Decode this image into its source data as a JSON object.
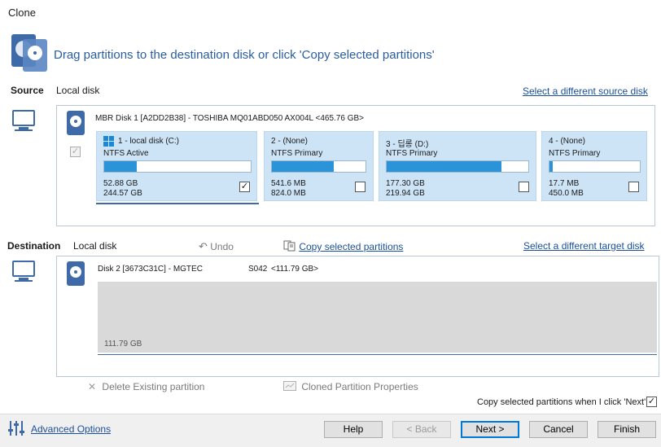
{
  "window": {
    "title": "Clone"
  },
  "header": {
    "instruction": "Drag partitions to the destination disk or click 'Copy selected partitions'"
  },
  "source": {
    "label": "Source",
    "disk_type": "Local disk",
    "select_link": "Select a different source disk",
    "disk_name": "MBR Disk 1 [A2DD2B38] - TOSHIBA MQ01ABD050 AX004L  <465.76 GB>",
    "partitions": [
      {
        "title": "1 - local disk (C:)",
        "fs": "NTFS Active",
        "used": "52.88 GB",
        "total": "244.57 GB",
        "fill_fraction": 0.22,
        "checked": true
      },
      {
        "title": "2 -  (None)",
        "fs": "NTFS Primary",
        "used": "541.6 MB",
        "total": "824.0 MB",
        "fill_fraction": 0.66,
        "checked": false
      },
      {
        "title": "3 - 딥롱 (D:)",
        "fs": "NTFS Primary",
        "used": "177.30 GB",
        "total": "219.94 GB",
        "fill_fraction": 0.81,
        "checked": false
      },
      {
        "title": "4 -  (None)",
        "fs": "NTFS Primary",
        "used": "17.7 MB",
        "total": "450.0 MB",
        "fill_fraction": 0.04,
        "checked": false
      }
    ]
  },
  "destination": {
    "label": "Destination",
    "disk_type": "Local disk",
    "undo": "Undo",
    "copy_link": "Copy selected partitions",
    "select_link": "Select a different target disk",
    "disk_name": "Disk 2 [3673C31C] - MGTEC",
    "disk_model": "S042",
    "disk_size": "<111.79 GB>",
    "unallocated_size": "111.79 GB"
  },
  "actions": {
    "delete_existing": "Delete Existing partition",
    "cloned_props": "Cloned Partition Properties",
    "copy_on_next": "Copy selected partitions when I click 'Next'"
  },
  "footer": {
    "advanced": "Advanced Options",
    "help": "Help",
    "back": "< Back",
    "next": "Next >",
    "cancel": "Cancel",
    "finish": "Finish"
  },
  "colors": {
    "accent": "#2a5d9f",
    "partition_bg": "#cde4f7",
    "bar_fill": "#2b93d7"
  },
  "icons": {
    "header": "clone-disk-icon",
    "monitor": "monitor-icon",
    "disk": "hard-disk-icon",
    "windows": "windows-logo-icon",
    "undo": "undo-icon",
    "copy": "copy-icon",
    "delete": "delete-x-icon",
    "properties": "properties-icon",
    "options": "sliders-icon"
  }
}
